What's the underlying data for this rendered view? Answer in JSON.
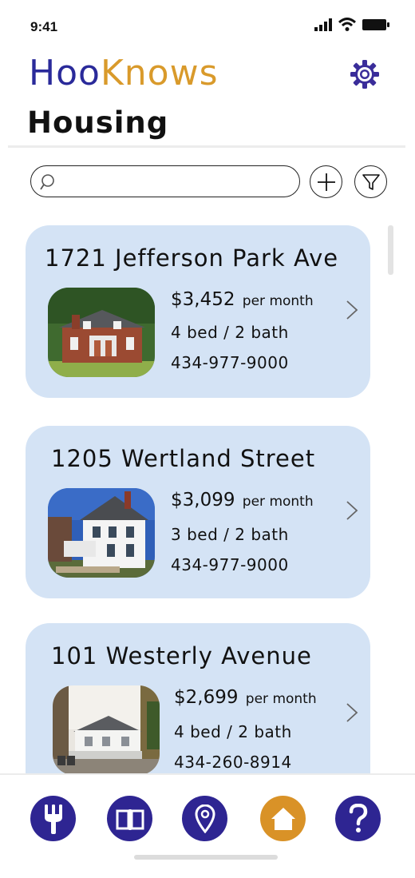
{
  "status_bar": {
    "time": "9:41"
  },
  "header": {
    "brand_part1": "Hoo",
    "brand_part2": "Knows",
    "page_title": "Housing",
    "brand_colors": {
      "hoo": "#2a2a9a",
      "knows": "#d99a2b"
    }
  },
  "search": {
    "placeholder": "",
    "value": ""
  },
  "toolbar": {
    "add_icon": "plus-icon",
    "filter_icon": "filter-icon",
    "settings_icon": "gear-icon"
  },
  "listings": [
    {
      "address": "1721 Jefferson Park Ave",
      "price": "$3,452",
      "price_unit": "per month",
      "beds_baths": "4 bed / 2 bath",
      "phone": "434-977-9000"
    },
    {
      "address": "1205 Wertland Street",
      "price": "$3,099",
      "price_unit": "per month",
      "beds_baths": "3 bed / 2 bath",
      "phone": "434-977-9000"
    },
    {
      "address": "101 Westerly Avenue",
      "price": "$2,699",
      "price_unit": "per month",
      "beds_baths": "4 bed / 2 bath",
      "phone": "434-260-8914"
    }
  ],
  "bottom_nav": {
    "items": [
      {
        "icon": "fork-icon",
        "active": false
      },
      {
        "icon": "book-icon",
        "active": false
      },
      {
        "icon": "map-pin-icon",
        "active": false
      },
      {
        "icon": "home-icon",
        "active": true
      },
      {
        "icon": "help-icon",
        "active": false
      }
    ],
    "colors": {
      "default": "#2e2592",
      "active": "#d99227"
    }
  },
  "colors": {
    "card_background": "#d4e3f5"
  }
}
